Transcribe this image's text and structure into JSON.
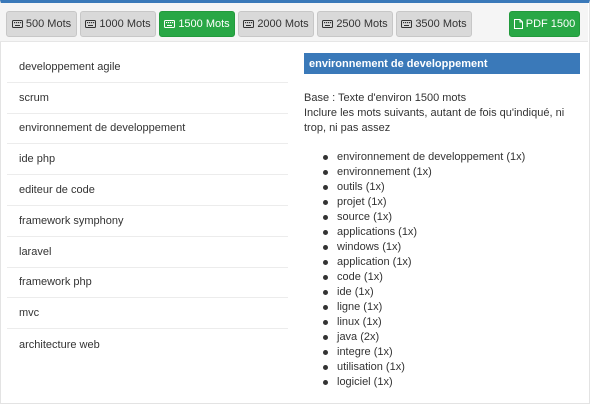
{
  "toolbar": {
    "buttons": [
      {
        "label": "500 Mots",
        "active": false
      },
      {
        "label": "1000 Mots",
        "active": false
      },
      {
        "label": "1500 Mots",
        "active": true
      },
      {
        "label": "2000 Mots",
        "active": false
      },
      {
        "label": "2500 Mots",
        "active": false
      },
      {
        "label": "3500 Mots",
        "active": false
      }
    ],
    "pdf_label": "PDF 1500"
  },
  "sidebar": {
    "items": [
      {
        "label": "developpement agile"
      },
      {
        "label": "scrum"
      },
      {
        "label": "environnement de developpement"
      },
      {
        "label": "ide php"
      },
      {
        "label": "editeur de code"
      },
      {
        "label": "framework symphony"
      },
      {
        "label": "laravel"
      },
      {
        "label": "framework php"
      },
      {
        "label": "mvc"
      },
      {
        "label": "architecture web"
      }
    ]
  },
  "panel": {
    "title": "environnement de developpement",
    "base_line": "Base : Texte d'environ 1500 mots",
    "instruction": "Inclure les mots suivants, autant de fois qu'indiqué, ni trop, ni pas assez",
    "keywords": [
      "environnement de developpement (1x)",
      "environnement (1x)",
      "outils (1x)",
      "projet (1x)",
      "source (1x)",
      "applications (1x)",
      "windows (1x)",
      "application (1x)",
      "code (1x)",
      "ide (1x)",
      "ligne (1x)",
      "linux (1x)",
      "java (2x)",
      "integre (1x)",
      "utilisation (1x)",
      "logiciel (1x)"
    ]
  },
  "colors": {
    "accent": "#3a79b9",
    "success": "#28a745",
    "button_default": "#d9d9d9"
  },
  "icons": {
    "word_button": "keyboard-icon",
    "pdf_button": "file-pdf-icon"
  }
}
